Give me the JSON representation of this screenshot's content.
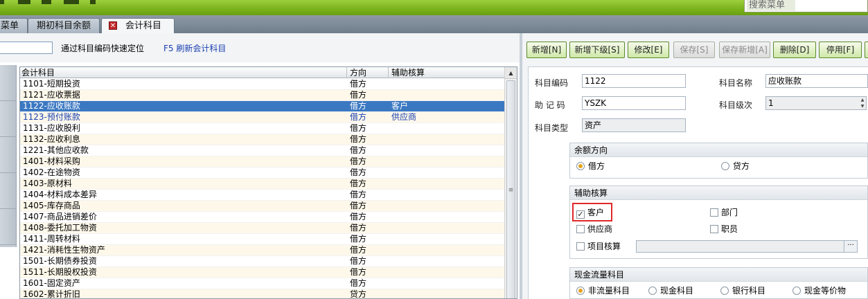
{
  "banner": {
    "search_placeholder": "搜索菜单"
  },
  "tabs": [
    {
      "label": "菜单"
    },
    {
      "label": "期初科目余额"
    },
    {
      "label": "会计科目",
      "close_glyph": "✕"
    }
  ],
  "filter": {
    "locate_value": "",
    "locate_hint": "通过科目编码快速定位",
    "refresh_label": "F5 刷新会计科目"
  },
  "grid": {
    "headers": {
      "name": "会计科目",
      "direction": "方向",
      "aux": "辅助核算"
    },
    "rows": [
      {
        "name": "1101-短期投资",
        "direction": "借方",
        "aux": ""
      },
      {
        "name": "1121-应收票据",
        "direction": "借方",
        "aux": ""
      },
      {
        "name": "1122-应收账款",
        "direction": "借方",
        "aux": "客户"
      },
      {
        "name": "1123-预付账款",
        "direction": "借方",
        "aux": "供应商"
      },
      {
        "name": "1131-应收股利",
        "direction": "借方",
        "aux": ""
      },
      {
        "name": "1132-应收利息",
        "direction": "借方",
        "aux": ""
      },
      {
        "name": "1221-其他应收款",
        "direction": "借方",
        "aux": ""
      },
      {
        "name": "1401-材料采购",
        "direction": "借方",
        "aux": ""
      },
      {
        "name": "1402-在途物资",
        "direction": "借方",
        "aux": ""
      },
      {
        "name": "1403-原材料",
        "direction": "借方",
        "aux": ""
      },
      {
        "name": "1404-材料成本差异",
        "direction": "借方",
        "aux": ""
      },
      {
        "name": "1405-库存商品",
        "direction": "借方",
        "aux": ""
      },
      {
        "name": "1407-商品进销差价",
        "direction": "借方",
        "aux": ""
      },
      {
        "name": "1408-委托加工物资",
        "direction": "借方",
        "aux": ""
      },
      {
        "name": "1411-周转材料",
        "direction": "借方",
        "aux": ""
      },
      {
        "name": "1421-消耗性生物资产",
        "direction": "借方",
        "aux": ""
      },
      {
        "name": "1501-长期债券投资",
        "direction": "借方",
        "aux": ""
      },
      {
        "name": "1511-长期股权投资",
        "direction": "借方",
        "aux": ""
      },
      {
        "name": "1601-固定资产",
        "direction": "借方",
        "aux": ""
      },
      {
        "name": "1602-累计折旧",
        "direction": "贷方",
        "aux": ""
      }
    ],
    "selected_row": 2,
    "linked_row": 3
  },
  "toolbar": {
    "add": "新增[N]",
    "add_child": "新增下级[S]",
    "edit": "修改[E]",
    "save": "保存[S]",
    "save_add": "保存新增[A]",
    "delete": "删除[D]",
    "disable": "停用[F]"
  },
  "form": {
    "code_label": "科目编码",
    "code_value": "1122",
    "name_label": "科目名称",
    "name_value": "应收账款",
    "mnemonic_label": "助 记 码",
    "mnemonic_value": "YSZK",
    "level_label": "科目级次",
    "level_value": "1",
    "type_label": "科目类型",
    "type_value": "资产"
  },
  "balance_direction": {
    "title": "余额方向",
    "debit": "借方",
    "credit": "贷方",
    "selected": "debit"
  },
  "aux_accounting": {
    "title": "辅助核算",
    "customer": "客户",
    "department": "部门",
    "supplier": "供应商",
    "employee": "职员",
    "project": "项目核算",
    "customer_checked": true,
    "more_glyph": "···"
  },
  "cash_flow": {
    "title": "现金流量科目",
    "non_cash": "非流量科目",
    "cash": "现金科目",
    "bank": "银行科目",
    "cash_equiv": "现金等价物",
    "selected": "non_cash"
  },
  "colors": {
    "banner_green": "#7ab21c",
    "selected_row": "#3b78c2",
    "link_blue": "#1a3fb0",
    "highlight_red": "#e0282a",
    "radio_on": "#e5a21d"
  }
}
